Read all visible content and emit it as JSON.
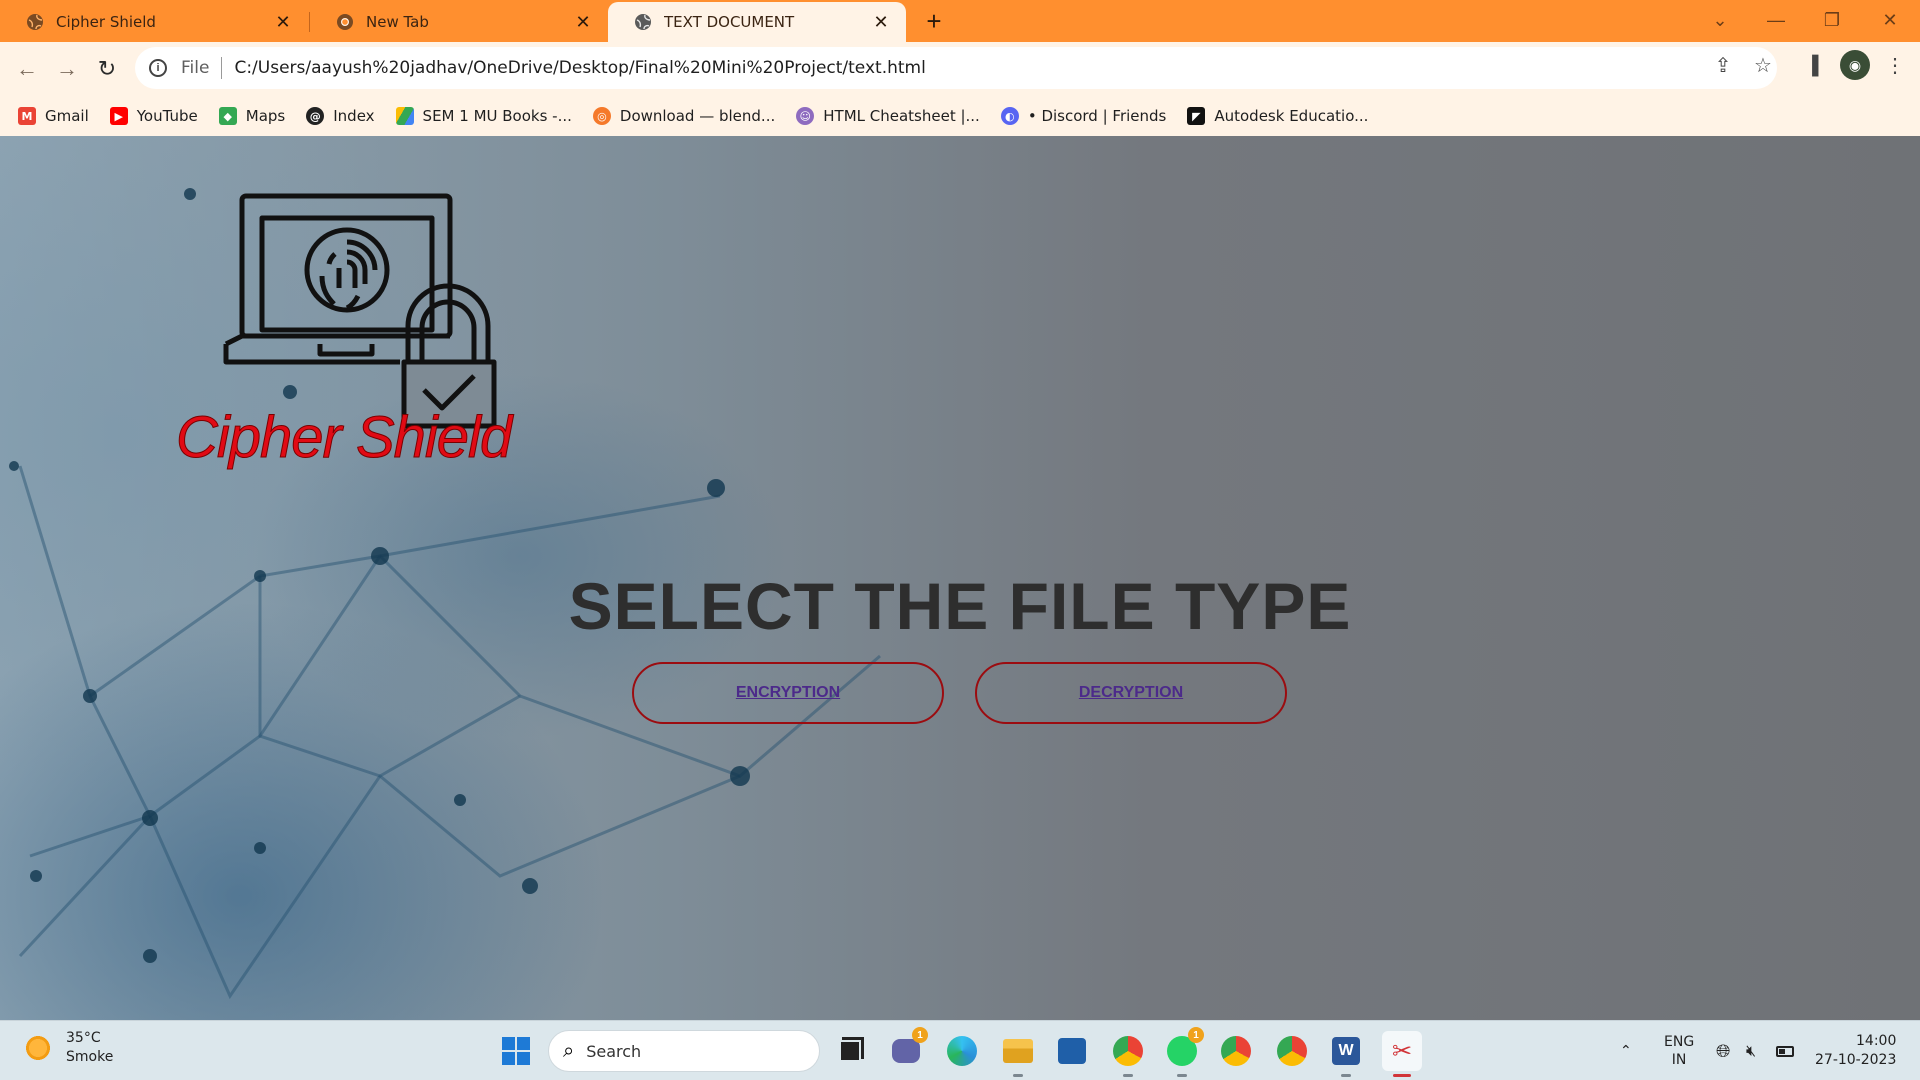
{
  "browser": {
    "tabs": [
      {
        "title": "Cipher Shield",
        "active": false
      },
      {
        "title": "New Tab",
        "active": false
      },
      {
        "title": "TEXT DOCUMENT",
        "active": true
      }
    ],
    "omnibox": {
      "scheme_label": "File",
      "url": "C:/Users/aayush%20jadhav/OneDrive/Desktop/Final%20Mini%20Project/text.html"
    },
    "bookmarks": [
      {
        "label": "Gmail",
        "icon": "gmail-icon",
        "color": "#ea4335"
      },
      {
        "label": "YouTube",
        "icon": "youtube-icon",
        "color": "#ff0000"
      },
      {
        "label": "Maps",
        "icon": "maps-icon",
        "color": "#34a853"
      },
      {
        "label": "Index",
        "icon": "index-icon",
        "color": "#222222"
      },
      {
        "label": "SEM 1 MU Books -...",
        "icon": "google-drive-icon",
        "color": "#fbbc04"
      },
      {
        "label": "Download — blend...",
        "icon": "blender-icon",
        "color": "#f5792a"
      },
      {
        "label": "HTML Cheatsheet |...",
        "icon": "profile-icon",
        "color": "#8e6bbf"
      },
      {
        "label": "• Discord | Friends",
        "icon": "discord-icon",
        "color": "#5865f2"
      },
      {
        "label": "Autodesk Educatio...",
        "icon": "autodesk-icon",
        "color": "#111111"
      }
    ]
  },
  "page": {
    "logo_text": "Cipher Shield",
    "heading": "SELECT THE FILE TYPE",
    "buttons": {
      "encryption": "ENCRYPTION",
      "decryption": "DECRYPTION"
    },
    "colors": {
      "logo_red": "#e10a14",
      "button_border": "#9b0c10",
      "link_purple": "#4c2a8a",
      "heading": "#2e2e2e"
    }
  },
  "taskbar": {
    "weather": {
      "temp": "35°C",
      "condition": "Smoke"
    },
    "search_label": "Search",
    "badges": {
      "teams": "1",
      "whatsapp": "1"
    },
    "tray": {
      "language_line1": "ENG",
      "language_line2": "IN",
      "time": "14:00",
      "date": "27-10-2023"
    }
  },
  "theme": {
    "tabstrip": "#ff8f2f",
    "toolbar": "#fff3e6"
  }
}
